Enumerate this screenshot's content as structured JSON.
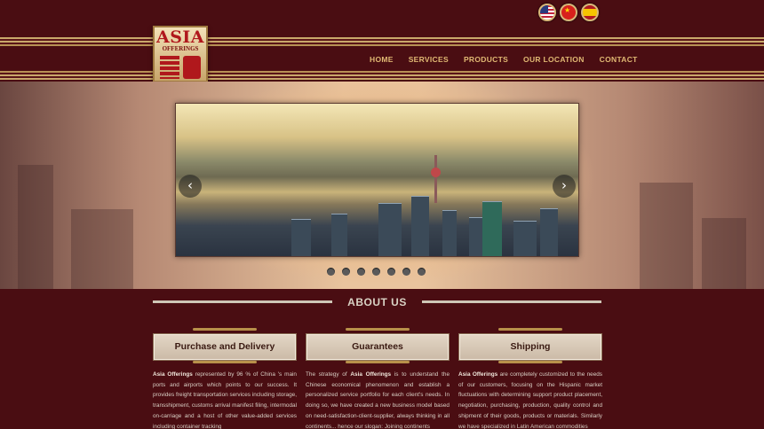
{
  "header": {
    "logo": {
      "title": "ASIA",
      "subtitle": "OFFERINGS"
    },
    "flags": [
      {
        "name": "us-flag-icon"
      },
      {
        "name": "china-flag-icon"
      },
      {
        "name": "spain-flag-icon"
      }
    ],
    "nav": [
      "HOME",
      "SERVICES",
      "PRODUCTS",
      "OUR LOCATION",
      "CONTACT"
    ]
  },
  "slider": {
    "prev_icon": "‹",
    "next_icon": "›",
    "dot_count": 7
  },
  "about": {
    "title": "ABOUT US",
    "columns": [
      {
        "heading": "Purchase and Delivery",
        "lead": "Asia Offerings",
        "text": " represented by 96 % of China 's main ports and airports which points to our success. It provides freight transportation services including storage, transshipment, customs arrival manifest filing, intermodal on-carriage and a host of other value-added services including container tracking"
      },
      {
        "heading": "Guarantees",
        "lead_pre": "The strategy of ",
        "lead": "Asia Offerings",
        "text": " is to understand the Chinese economical phenomenon and establish a personalized service portfolio for each client's needs. In doing so, we have created a new business model based on need-satisfaction-client-supplier, always thinking in all continents... hence our slogan: Joining continents"
      },
      {
        "heading": "Shipping",
        "lead": "Asia Offerings",
        "text": " are completely customized to the needs of our customers, focusing on the Hispanic market fluctuations with determining support product placement, negotiation, purchasing, production, quality control and shipment of their goods, products or materials. Similarly we have specialized in Latin American commodities"
      }
    ]
  }
}
